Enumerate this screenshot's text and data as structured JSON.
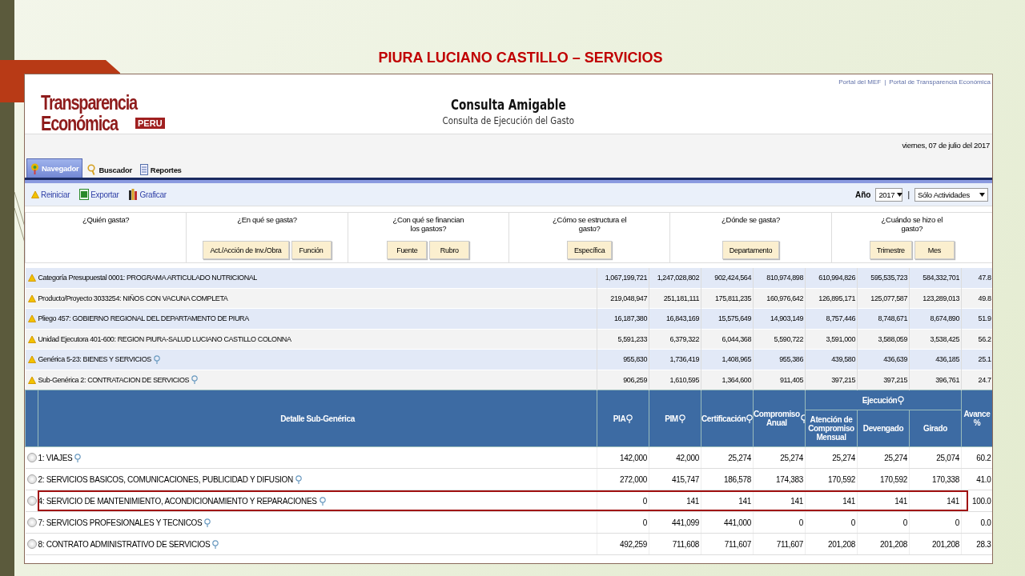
{
  "slide_title": "PIURA LUCIANO CASTILLO – SERVICIOS",
  "header": {
    "links": [
      "Portal del MEF",
      "Portal de Transparencia Económica"
    ],
    "link_separator": "|",
    "logo": {
      "line1": "Transparencia",
      "line2": "Económica",
      "badge": "PERU"
    },
    "title": "Consulta Amigable",
    "subtitle": "Consulta de Ejecución del Gasto",
    "date": "viernes, 07 de julio del 2017"
  },
  "tabs": [
    {
      "label": "Navegador",
      "kind": "navigator",
      "selected": true
    },
    {
      "label": "Buscador",
      "kind": "search",
      "selected": false
    },
    {
      "label": "Reportes",
      "kind": "report",
      "selected": false
    }
  ],
  "toolbar": {
    "actions": [
      {
        "label": "Reiniciar",
        "kind": "reset"
      },
      {
        "label": "Exportar",
        "kind": "export"
      },
      {
        "label": "Graficar",
        "kind": "chart"
      }
    ],
    "year_label": "Año",
    "year": "2017",
    "separator": "|",
    "filter": "Sólo Actividades"
  },
  "questions": [
    {
      "label": "¿Quién gasta?"
    },
    {
      "label": "¿En qué se gasta?",
      "buttons": [
        "Act./Acción de Inv./Obra",
        "Función"
      ]
    },
    {
      "label": "¿Con qué se financian los gastos?",
      "buttons": [
        "Fuente",
        "Rubro"
      ]
    },
    {
      "label": "¿Cómo se estructura el gasto?",
      "buttons": [
        "Específica"
      ]
    },
    {
      "label": "¿Dónde se gasta?",
      "buttons": [
        "Departamento"
      ]
    },
    {
      "label": "¿Cuándo se hizo el gasto?",
      "buttons": [
        "Trimestre",
        "Mes"
      ]
    }
  ],
  "summary_rows": [
    {
      "label": "Categoría Presupuestal 0001: PROGRAMA ARTICULADO NUTRICIONAL",
      "filter": false,
      "values": [
        "1,067,199,721",
        "1,247,028,802",
        "902,424,564",
        "810,974,898",
        "610,994,826",
        "595,535,723",
        "584,332,701",
        "47.8"
      ]
    },
    {
      "label": "Producto/Proyecto 3033254: NIÑOS CON VACUNA COMPLETA",
      "filter": false,
      "values": [
        "219,048,947",
        "251,181,111",
        "175,811,235",
        "160,976,642",
        "126,895,171",
        "125,077,587",
        "123,289,013",
        "49.8"
      ]
    },
    {
      "label": "Pliego 457: GOBIERNO REGIONAL DEL DEPARTAMENTO DE PIURA",
      "filter": false,
      "values": [
        "16,187,380",
        "16,843,169",
        "15,575,649",
        "14,903,149",
        "8,757,446",
        "8,748,671",
        "8,674,890",
        "51.9"
      ]
    },
    {
      "label": "Unidad Ejecutora 401-600: REGION PIURA-SALUD LUCIANO CASTILLO COLONNA",
      "filter": false,
      "values": [
        "5,591,233",
        "6,379,322",
        "6,044,368",
        "5,590,722",
        "3,591,000",
        "3,588,059",
        "3,538,425",
        "56.2"
      ]
    },
    {
      "label": "Genérica 5-23: BIENES Y SERVICIOS",
      "filter": true,
      "values": [
        "955,830",
        "1,736,419",
        "1,408,965",
        "955,386",
        "439,580",
        "436,639",
        "436,185",
        "25.1"
      ]
    },
    {
      "label": "Sub-Genérica 2: CONTRATACION DE SERVICIOS",
      "filter": true,
      "values": [
        "906,259",
        "1,610,595",
        "1,364,600",
        "911,405",
        "397,215",
        "397,215",
        "396,761",
        "24.7"
      ]
    }
  ],
  "table": {
    "detail_header": "Detalle Sub-Genérica",
    "columns": [
      {
        "label": "PIA",
        "filter": true
      },
      {
        "label": "PIM",
        "filter": true
      },
      {
        "label": "Certificación",
        "filter": true
      },
      {
        "label": "Compromiso Anual",
        "filter": true
      },
      {
        "label": "Ejecución",
        "filter": true,
        "children": [
          {
            "label": "Atención de Compromiso Mensual"
          },
          {
            "label": "Devengado"
          },
          {
            "label": "Girado"
          }
        ]
      },
      {
        "label": "Avance %",
        "filter": false
      }
    ],
    "rows": [
      {
        "label": "1: VIAJES",
        "selected": false,
        "highlighted": false,
        "values": [
          "142,000",
          "42,000",
          "25,274",
          "25,274",
          "25,274",
          "25,274",
          "25,074",
          "60.2"
        ]
      },
      {
        "label": "2: SERVICIOS BASICOS, COMUNICACIONES, PUBLICIDAD Y DIFUSION",
        "selected": false,
        "highlighted": false,
        "values": [
          "272,000",
          "415,747",
          "186,578",
          "174,383",
          "170,592",
          "170,592",
          "170,338",
          "41.0"
        ]
      },
      {
        "label": "4: SERVICIO DE MANTENIMIENTO, ACONDICIONAMIENTO Y REPARACIONES",
        "selected": false,
        "highlighted": true,
        "values": [
          "0",
          "141",
          "141",
          "141",
          "141",
          "141",
          "141",
          "100.0"
        ]
      },
      {
        "label": "7: SERVICIOS PROFESIONALES Y TECNICOS",
        "selected": false,
        "highlighted": false,
        "values": [
          "0",
          "441,099",
          "441,000",
          "0",
          "0",
          "0",
          "0",
          "0.0"
        ]
      },
      {
        "label": "8: CONTRATO ADMINISTRATIVO DE SERVICIOS",
        "selected": false,
        "highlighted": false,
        "values": [
          "492,259",
          "711,608",
          "711,607",
          "711,607",
          "201,208",
          "201,208",
          "201,208",
          "28.3"
        ]
      }
    ]
  }
}
